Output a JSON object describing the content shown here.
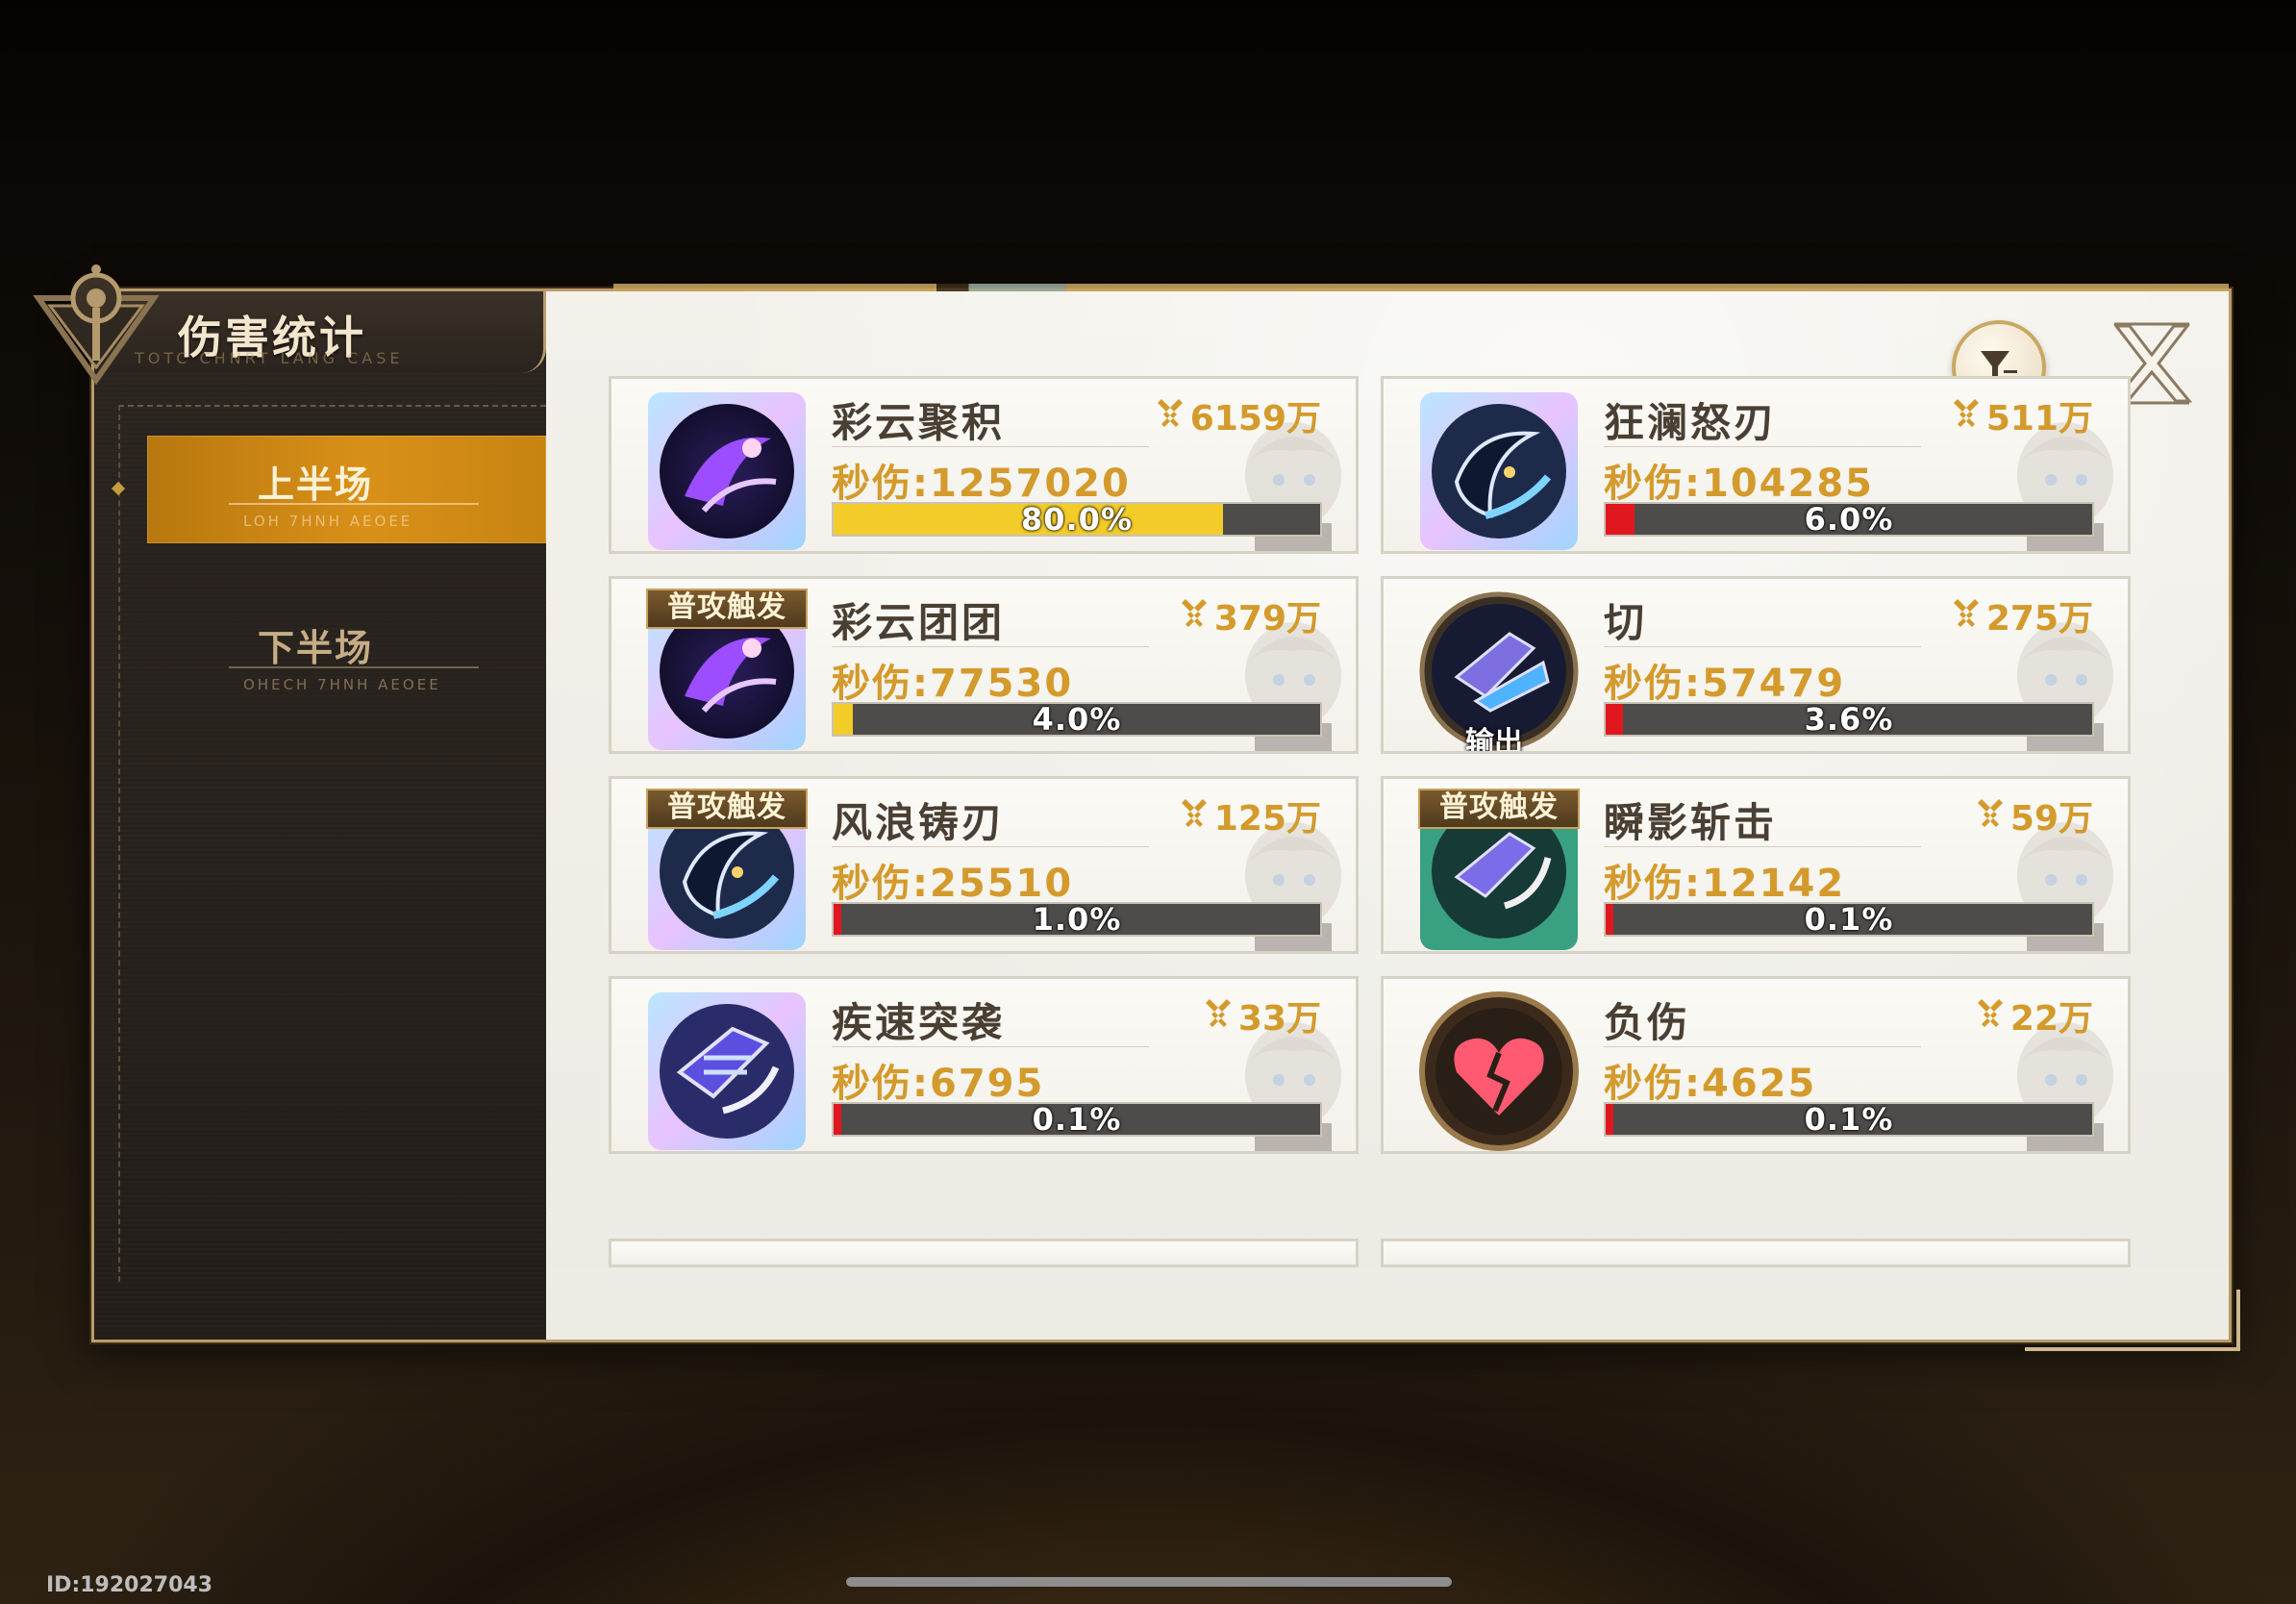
{
  "header": {
    "title": "伤害统计",
    "subtitle": "TOTC CHNRT LANG CASE"
  },
  "sidebar": {
    "tabs": [
      {
        "label": "上半场",
        "sub": "LOH 7HNH AEOEE",
        "active": true
      },
      {
        "label": "下半场",
        "sub": "OHECH 7HNH AEOEE",
        "active": false
      }
    ]
  },
  "colors": {
    "accent_gold": "#d49a2c",
    "bar_yellow": "#f3cc2a",
    "bar_red": "#e0171f",
    "active_tab": "#d99018"
  },
  "skills": [
    {
      "name": "彩云聚积",
      "damage": "6159万",
      "dps": "秒伤:1257020",
      "share_text": "80.0%",
      "share": 0.8,
      "bar_color": "#f3cc2a",
      "icon": "purple-scythe-icon",
      "badge": "",
      "output_label": ""
    },
    {
      "name": "狂澜怒刃",
      "damage": "511万",
      "dps": "秒伤:104285",
      "share_text": "6.0%",
      "share": 0.06,
      "bar_color": "#e0171f",
      "icon": "wave-blade-icon",
      "badge": "",
      "output_label": ""
    },
    {
      "name": "彩云团团",
      "damage": "379万",
      "dps": "秒伤:77530",
      "share_text": "4.0%",
      "share": 0.04,
      "bar_color": "#f3cc2a",
      "icon": "purple-scythe-icon",
      "badge": "普攻触发",
      "output_label": ""
    },
    {
      "name": "切",
      "damage": "275万",
      "dps": "秒伤:57479",
      "share_text": "3.6%",
      "share": 0.036,
      "bar_color": "#e0171f",
      "icon": "cut-blade-icon",
      "badge": "",
      "output_label": "输出"
    },
    {
      "name": "风浪铸刃",
      "damage": "125万",
      "dps": "秒伤:25510",
      "share_text": "1.0%",
      "share": 0.01,
      "bar_color": "#e0171f",
      "icon": "wave-blade-icon",
      "badge": "普攻触发",
      "output_label": ""
    },
    {
      "name": "瞬影斩击",
      "damage": "59万",
      "dps": "秒伤:12142",
      "share_text": "0.1%",
      "share": 0.001,
      "bar_color": "#e0171f",
      "icon": "shadow-slash-icon",
      "badge": "普攻触发",
      "output_label": ""
    },
    {
      "name": "疾速突袭",
      "damage": "33万",
      "dps": "秒伤:6795",
      "share_text": "0.1%",
      "share": 0.001,
      "bar_color": "#e0171f",
      "icon": "rapid-strike-icon",
      "badge": "",
      "output_label": ""
    },
    {
      "name": "负伤",
      "damage": "22万",
      "dps": "秒伤:4625",
      "share_text": "0.1%",
      "share": 0.001,
      "bar_color": "#e0171f",
      "icon": "broken-heart-icon",
      "badge": "",
      "output_label": ""
    }
  ],
  "footer": {
    "id_text": "ID:192027043"
  }
}
